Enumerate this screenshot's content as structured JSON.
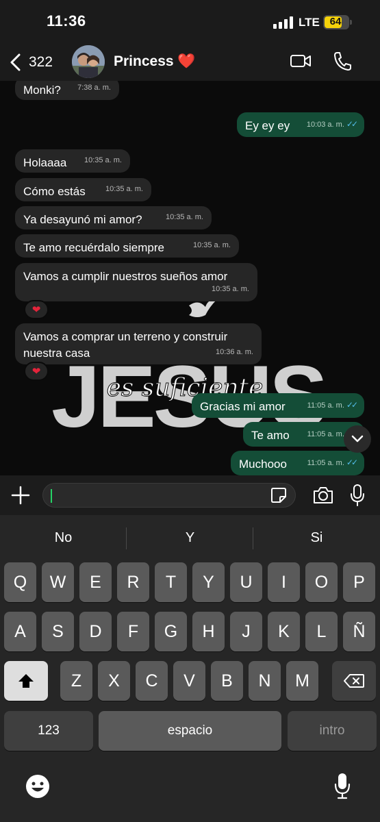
{
  "status_bar": {
    "time": "11:36",
    "network": "LTE",
    "battery_level": "64"
  },
  "header": {
    "back_count": "322",
    "contact_name": "Princess ❤️"
  },
  "wallpaper": {
    "main_text": "JESÚS",
    "script_text": "es suficiente"
  },
  "messages": [
    {
      "dir": "in",
      "text": "Monki?",
      "time": "7:38 a. m."
    },
    {
      "dir": "out",
      "text": "Ey ey ey",
      "time": "10:03 a. m.",
      "ticks": "✓✓"
    },
    {
      "dir": "in",
      "text": "Holaaaa",
      "time": "10:35 a. m."
    },
    {
      "dir": "in",
      "text": "Cómo estás",
      "time": "10:35 a. m."
    },
    {
      "dir": "in",
      "text": "Ya desayunó mi amor?",
      "time": "10:35 a. m."
    },
    {
      "dir": "in",
      "text": "Te amo recuérdalo siempre",
      "time": "10:35 a. m."
    },
    {
      "dir": "in",
      "text": "Vamos a cumplir nuestros sueños amor",
      "time": "10:35 a. m.",
      "reaction": "❤"
    },
    {
      "dir": "in",
      "text": "Vamos a comprar un terreno y construir nuestra casa",
      "time": "10:36 a. m.",
      "reaction": "❤"
    },
    {
      "dir": "out",
      "text": "Gracias mi amor",
      "time": "11:05 a. m.",
      "ticks": "✓✓"
    },
    {
      "dir": "out",
      "text": "Te amo",
      "time": "11:05 a. m.",
      "ticks": "✓✓"
    },
    {
      "dir": "out",
      "text": "Muchooo",
      "time": "11:05 a. m.",
      "ticks": "✓✓"
    }
  ],
  "input": {
    "value": ""
  },
  "keyboard": {
    "suggestions": [
      "No",
      "Y",
      "Si"
    ],
    "row1": [
      "Q",
      "W",
      "E",
      "R",
      "T",
      "Y",
      "U",
      "I",
      "O",
      "P"
    ],
    "row2": [
      "A",
      "S",
      "D",
      "F",
      "G",
      "H",
      "J",
      "K",
      "L",
      "Ñ"
    ],
    "row3": [
      "Z",
      "X",
      "C",
      "V",
      "B",
      "N",
      "M"
    ],
    "numbers_label": "123",
    "space_label": "espacio",
    "return_label": "intro"
  },
  "colors": {
    "incoming": "#262626",
    "outgoing": "#144d37",
    "accent": "#25d366",
    "read_ticks": "#53bdeb"
  }
}
